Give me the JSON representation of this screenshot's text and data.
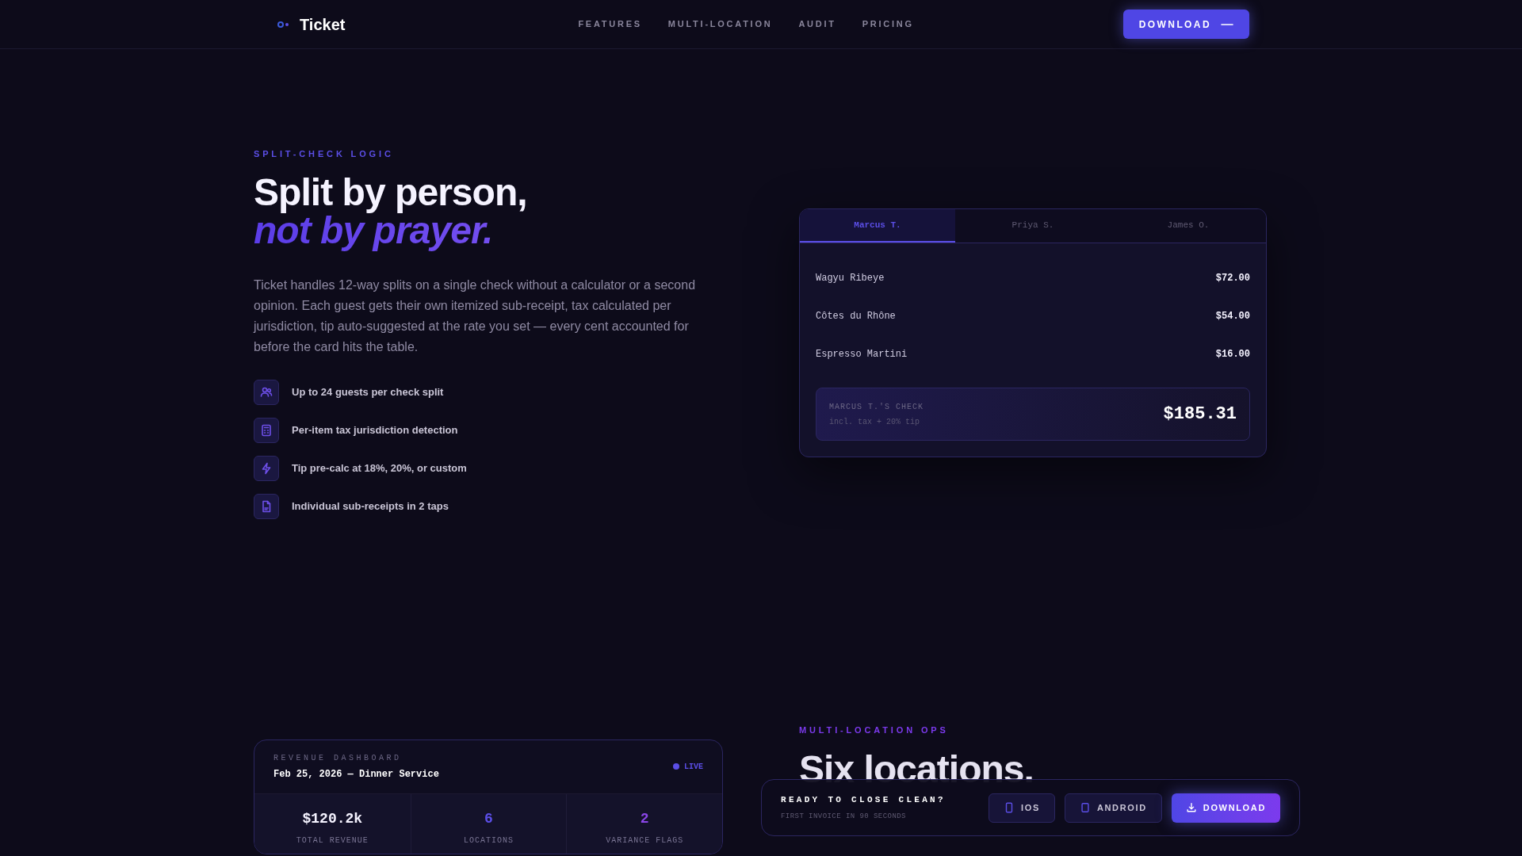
{
  "header": {
    "brand": "Ticket",
    "nav": [
      "FEATURES",
      "MULTI-LOCATION",
      "AUDIT",
      "PRICING"
    ],
    "cta": "DOWNLOAD"
  },
  "split_section": {
    "eyebrow": "SPLIT-CHECK LOGIC",
    "heading_line_1": "Split by person,",
    "heading_line_2": "not by prayer.",
    "body": "Ticket handles 12-way splits on a single check without a calculator or a second opinion. Each guest gets their own itemized sub-receipt, tax calculated per jurisdiction, tip auto-suggested at the rate you set — every cent accounted for before the card hits the table.",
    "features": [
      {
        "kind": "users",
        "label": "Up to 24 guests per check split"
      },
      {
        "kind": "calculator",
        "label": "Per-item tax jurisdiction detection"
      },
      {
        "kind": "bolt",
        "label": "Tip pre-calc at 18%, 20%, or custom"
      },
      {
        "kind": "file",
        "label": "Individual sub-receipts in 2 taps"
      }
    ]
  },
  "receipt": {
    "tabs": [
      {
        "label": "Marcus T.",
        "selected": true
      },
      {
        "label": "Priya S.",
        "selected": false
      },
      {
        "label": "James O.",
        "selected": false
      }
    ],
    "items": [
      {
        "name": "Wagyu Ribeye",
        "price": "$72.00"
      },
      {
        "name": "Côtes du Rhône",
        "price": "$54.00"
      },
      {
        "name": "Espresso Martini",
        "price": "$16.00"
      }
    ],
    "total": {
      "label": "MARCUS T.'S CHECK",
      "note": "incl. tax + 20% tip",
      "amount": "$185.31"
    }
  },
  "ops_section": {
    "eyebrow": "MULTI-LOCATION OPS",
    "heading": "Six locations."
  },
  "dashboard": {
    "eyebrow": "REVENUE DASHBOARD",
    "title": "Feb 25, 2026 — Dinner Service",
    "status": "LIVE",
    "stats": [
      {
        "value": "$120.2k",
        "label": "TOTAL REVENUE",
        "color": "#f5f3ff"
      },
      {
        "value": "6",
        "label": "LOCATIONS",
        "color": "#5b4ee6"
      },
      {
        "value": "2",
        "label": "VARIANCE FLAGS",
        "color": "#8b46e8"
      }
    ]
  },
  "cta_bar": {
    "title": "READY TO CLOSE CLEAN?",
    "subtitle": "FIRST INVOICE IN 90 SECONDS",
    "buttons": [
      {
        "kind": "ios",
        "label": "IOS"
      },
      {
        "kind": "android",
        "label": "ANDROID"
      },
      {
        "kind": "download",
        "label": "DOWNLOAD"
      }
    ]
  }
}
